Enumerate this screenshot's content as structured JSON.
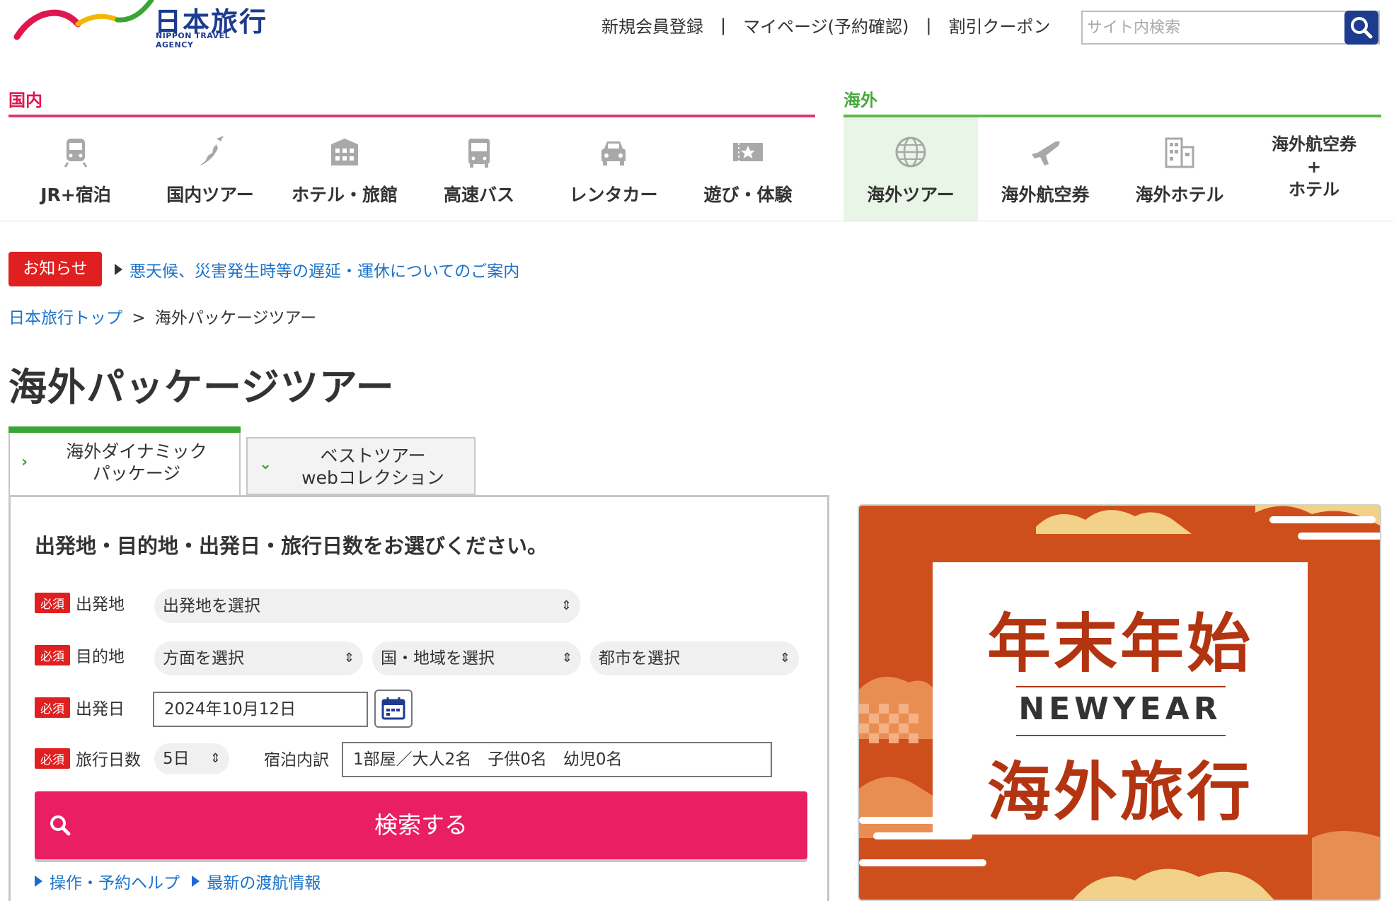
{
  "header": {
    "logo_jp": "日本旅行",
    "logo_en": "NIPPON TRAVEL AGENCY",
    "links": [
      "新規会員登録",
      "マイページ(予約確認)",
      "割引クーポン"
    ],
    "link_separator": "|",
    "search_placeholder": "サイト内検索"
  },
  "nav": {
    "domestic_label": "国内",
    "overseas_label": "海外",
    "domestic_items": [
      {
        "label": "JR+宿泊",
        "icon": "train-icon"
      },
      {
        "label": "国内ツアー",
        "icon": "japan-plane-icon"
      },
      {
        "label": "ホテル・旅館",
        "icon": "hotel-icon"
      },
      {
        "label": "高速バス",
        "icon": "bus-icon"
      },
      {
        "label": "レンタカー",
        "icon": "car-icon"
      },
      {
        "label": "遊び・体験",
        "icon": "ticket-icon"
      }
    ],
    "overseas_items": [
      {
        "label": "海外ツアー",
        "icon": "globe-icon",
        "active": true
      },
      {
        "label": "海外航空券",
        "icon": "airplane-icon"
      },
      {
        "label": "海外ホテル",
        "icon": "building-icon"
      },
      {
        "label_lines": [
          "海外航空券",
          "+",
          "ホテル"
        ]
      }
    ]
  },
  "notice": {
    "badge": "お知らせ",
    "link": "悪天候、災害発生時等の遅延・運休についてのご案内"
  },
  "breadcrumb": {
    "home": "日本旅行トップ",
    "separator": ">",
    "current": "海外パッケージツアー"
  },
  "page_title": "海外パッケージツアー",
  "tabs": [
    {
      "lines": [
        "海外ダイナミック",
        "パッケージ"
      ],
      "active": true
    },
    {
      "lines": [
        "ベストツアー",
        "webコレクション"
      ],
      "active": false
    }
  ],
  "form": {
    "heading": "出発地・目的地・出発日・旅行日数をお選びください。",
    "required_badge": "必須",
    "departure": {
      "label": "出発地",
      "value": "出発地を選択"
    },
    "destination": {
      "label": "目的地",
      "area": "方面を選択",
      "country": "国・地域を選択",
      "city": "都市を選択"
    },
    "date": {
      "label": "出発日",
      "value": "2024年10月12日"
    },
    "days": {
      "label": "旅行日数",
      "value": "5日"
    },
    "rooms": {
      "label": "宿泊内訳",
      "value": "1部屋／大人2名　子供0名　幼児0名"
    },
    "submit": "検索する",
    "help_links": [
      "操作・予約ヘルプ",
      "最新の渡航情報"
    ]
  },
  "banner": {
    "line1": "年末年始",
    "line2": "NEWYEAR",
    "line3": "海外旅行"
  },
  "colors": {
    "brand_blue": "#1d3b8f",
    "domestic_red": "#e0174f",
    "overseas_green": "#46a83c",
    "search_pink": "#e91e63",
    "link_blue": "#1a73c9",
    "banner_orange": "#cf4f1c"
  }
}
